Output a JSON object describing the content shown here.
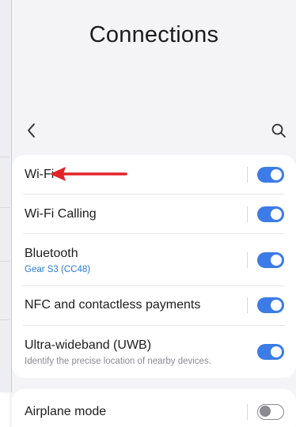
{
  "header": {
    "title": "Connections"
  },
  "icons": {
    "back": "chevron-left-icon",
    "search": "search-icon",
    "annotation": "red-arrow-icon"
  },
  "colors": {
    "toggle_on": "#3d7be6",
    "toggle_off": "#8a8a90",
    "accent_sub": "#2a7bd1",
    "annotation_arrow": "#e32228"
  },
  "settings": {
    "items": [
      {
        "label": "Wi-Fi",
        "sublabel": "",
        "enabled": true
      },
      {
        "label": "Wi-Fi Calling",
        "sublabel": "",
        "enabled": true
      },
      {
        "label": "Bluetooth",
        "sublabel": "Gear S3 (CC48)",
        "enabled": true
      },
      {
        "label": "NFC and contactless payments",
        "sublabel": "",
        "enabled": true
      },
      {
        "label": "Ultra-wideband (UWB)",
        "sublabel": "Identify the precise location of nearby devices.",
        "enabled": true
      }
    ],
    "secondary": [
      {
        "label": "Airplane mode",
        "enabled": false
      }
    ]
  }
}
